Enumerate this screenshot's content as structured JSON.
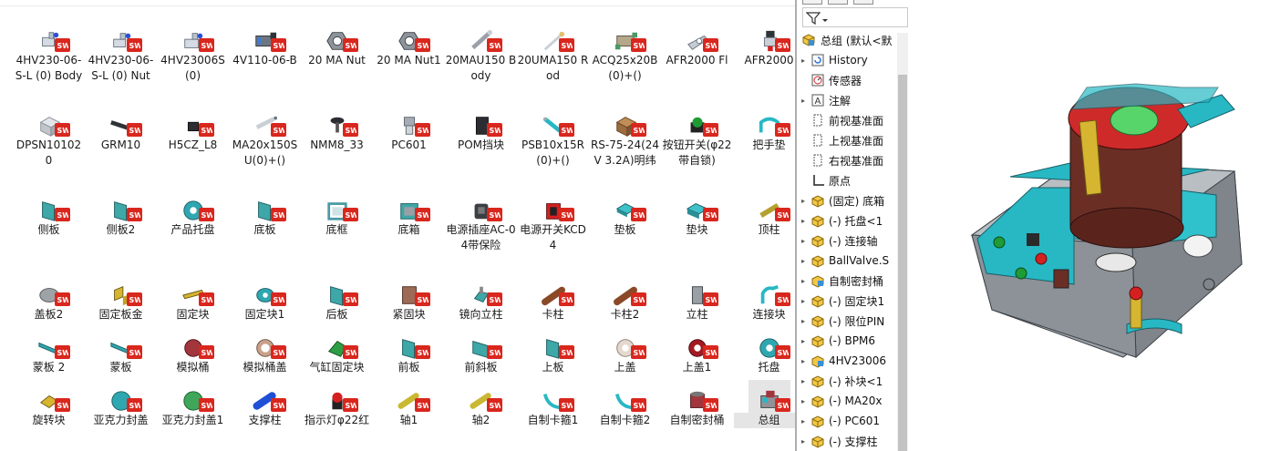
{
  "file_browser": {
    "items": [
      {
        "name": "4HV230-06-S-L (0) Body",
        "icon": "valve-body-icon",
        "rows": 1
      },
      {
        "name": "4HV230-06-S-L (0) Nut",
        "icon": "valve-nut-icon",
        "rows": 1
      },
      {
        "name": "4HV23006S(0)",
        "icon": "valve-icon",
        "rows": 1
      },
      {
        "name": "4V110-06-B",
        "icon": "solenoid-valve-icon",
        "rows": 1
      },
      {
        "name": "20 MA Nut",
        "icon": "hex-nut-icon",
        "rows": 1
      },
      {
        "name": "20 MA Nut1",
        "icon": "hex-nut-icon",
        "rows": 1
      },
      {
        "name": "20MAU150 Body",
        "icon": "cylinder-body-icon",
        "rows": 1
      },
      {
        "name": "20UMA150 Rod",
        "icon": "rod-icon",
        "rows": 1
      },
      {
        "name": "ACQ25x20B(0)+()",
        "icon": "compact-cylinder-icon",
        "rows": 1
      },
      {
        "name": "AFR2000 Fl",
        "icon": "bracket-icon",
        "rows": 1
      },
      {
        "name": "AFR2000",
        "icon": "filter-regulator-icon",
        "rows": 1
      },
      {
        "name": "DPSN101020",
        "icon": "box-part-icon",
        "rows": 2
      },
      {
        "name": "GRM10",
        "icon": "shaft-icon",
        "rows": 2
      },
      {
        "name": "H5CZ_L8",
        "icon": "small-block-icon",
        "rows": 2
      },
      {
        "name": "MA20x150SU(0)+()",
        "icon": "cylinder-icon",
        "rows": 2
      },
      {
        "name": "NMM8_33",
        "icon": "knob-icon",
        "rows": 2
      },
      {
        "name": "PC601",
        "icon": "fitting-icon",
        "rows": 2
      },
      {
        "name": "POM挡块",
        "icon": "stop-block-icon",
        "rows": 2
      },
      {
        "name": "PSB10x15R(0)+()",
        "icon": "spring-plunger-icon",
        "rows": 2
      },
      {
        "name": "RS-75-24(24V 3.2A)明纬",
        "icon": "power-supply-icon",
        "rows": 2
      },
      {
        "name": "按钮开关(φ22带自锁)",
        "icon": "push-button-icon",
        "rows": 2
      },
      {
        "name": "把手垫",
        "icon": "handle-icon",
        "rows": 2
      },
      {
        "name": "侧板",
        "icon": "plate-icon",
        "rows": 3
      },
      {
        "name": "侧板2",
        "icon": "plate-icon",
        "rows": 3
      },
      {
        "name": "产品托盘",
        "icon": "tray-icon",
        "rows": 3
      },
      {
        "name": "底板",
        "icon": "plate-icon",
        "rows": 3
      },
      {
        "name": "底框",
        "icon": "frame-icon",
        "rows": 3
      },
      {
        "name": "底箱",
        "icon": "box-icon",
        "rows": 3
      },
      {
        "name": "电源插座AC-04带保险",
        "icon": "socket-icon",
        "rows": 3
      },
      {
        "name": "电源开关KCD4",
        "icon": "switch-icon",
        "rows": 3
      },
      {
        "name": "垫板",
        "icon": "pad-plate-icon",
        "rows": 3
      },
      {
        "name": "垫块",
        "icon": "pad-block-icon",
        "rows": 3
      },
      {
        "name": "顶柱",
        "icon": "top-pillar-icon",
        "rows": 3
      },
      {
        "name": "盖板2",
        "icon": "cover-plate-icon",
        "rows": 4
      },
      {
        "name": "固定板金",
        "icon": "sheet-metal-icon",
        "rows": 4
      },
      {
        "name": "固定块",
        "icon": "fixed-block-icon",
        "rows": 4
      },
      {
        "name": "固定块1",
        "icon": "cylinder-part-icon",
        "rows": 4
      },
      {
        "name": "后板",
        "icon": "plate-icon",
        "rows": 4
      },
      {
        "name": "紧固块",
        "icon": "clamp-block-icon",
        "rows": 4
      },
      {
        "name": "镜向立柱",
        "icon": "pillar-icon",
        "rows": 4
      },
      {
        "name": "卡柱",
        "icon": "pin-icon",
        "rows": 4
      },
      {
        "name": "卡柱2",
        "icon": "pin-icon",
        "rows": 4
      },
      {
        "name": "立柱",
        "icon": "post-icon",
        "rows": 4
      },
      {
        "name": "连接块",
        "icon": "connector-icon",
        "rows": 4
      },
      {
        "name": "蒙板 2",
        "icon": "mask-plate-icon",
        "rows": 5
      },
      {
        "name": "蒙板",
        "icon": "mask-plate-icon",
        "rows": 5
      },
      {
        "name": "模拟桶",
        "icon": "barrel-icon",
        "rows": 5
      },
      {
        "name": "模拟桶盖",
        "icon": "ring-icon",
        "rows": 5
      },
      {
        "name": "气缸固定块",
        "icon": "bracket-green-icon",
        "rows": 5
      },
      {
        "name": "前板",
        "icon": "plate-icon",
        "rows": 5
      },
      {
        "name": "前斜板",
        "icon": "slant-plate-icon",
        "rows": 5
      },
      {
        "name": "上板",
        "icon": "plate-icon",
        "rows": 5
      },
      {
        "name": "上盖",
        "icon": "washer-icon",
        "rows": 5
      },
      {
        "name": "上盖1",
        "icon": "washer-red-icon",
        "rows": 5
      },
      {
        "name": "托盘",
        "icon": "tray-icon",
        "rows": 5
      },
      {
        "name": "旋转块",
        "icon": "rotary-block-icon",
        "rows": 6
      },
      {
        "name": "亚克力封盖",
        "icon": "disc-icon",
        "rows": 6
      },
      {
        "name": "亚克力封盖1",
        "icon": "disc-green-icon",
        "rows": 6
      },
      {
        "name": "支撑柱",
        "icon": "support-pillar-icon",
        "rows": 6
      },
      {
        "name": "指示灯φ22红",
        "icon": "indicator-light-icon",
        "rows": 6
      },
      {
        "name": "轴1",
        "icon": "shaft-yellow-icon",
        "rows": 6
      },
      {
        "name": "轴2",
        "icon": "shaft-yellow-icon",
        "rows": 6
      },
      {
        "name": "自制卡箍1",
        "icon": "clip-icon",
        "rows": 6
      },
      {
        "name": "自制卡箍2",
        "icon": "clip-icon",
        "rows": 6
      },
      {
        "name": "自制密封桶",
        "icon": "seal-barrel-icon",
        "rows": 6
      },
      {
        "name": "总组",
        "icon": "assembly-icon",
        "rows": 6,
        "selected": true
      }
    ]
  },
  "feature_tree": {
    "root_label": "总组 (默认<默",
    "items": [
      {
        "label": "History",
        "icon": "history-icon",
        "expand": true
      },
      {
        "label": "传感器",
        "icon": "sensor-icon",
        "expand": false
      },
      {
        "label": "注解",
        "icon": "annotation-icon",
        "expand": true
      },
      {
        "label": "前视基准面",
        "icon": "plane-icon",
        "expand": false
      },
      {
        "label": "上视基准面",
        "icon": "plane-icon",
        "expand": false
      },
      {
        "label": "右视基准面",
        "icon": "plane-icon",
        "expand": false
      },
      {
        "label": "原点",
        "icon": "origin-icon",
        "expand": false
      },
      {
        "label": "(固定) 底箱",
        "icon": "part-icon",
        "expand": true
      },
      {
        "label": "(-) 托盘<1",
        "icon": "part-icon",
        "expand": true
      },
      {
        "label": "(-) 连接轴",
        "icon": "part-icon",
        "expand": true
      },
      {
        "label": "BallValve.S",
        "icon": "part-icon",
        "expand": true
      },
      {
        "label": "自制密封桶",
        "icon": "subassembly-icon",
        "expand": true
      },
      {
        "label": "(-) 固定块1",
        "icon": "part-icon",
        "expand": true
      },
      {
        "label": "(-) 限位PIN",
        "icon": "part-icon",
        "expand": true
      },
      {
        "label": "(-) BPM6",
        "icon": "part-icon",
        "expand": true
      },
      {
        "label": "4HV23006",
        "icon": "subassembly-icon",
        "expand": true
      },
      {
        "label": "(-) 补块<1",
        "icon": "part-icon",
        "expand": true
      },
      {
        "label": "(-) MA20x",
        "icon": "part-icon",
        "expand": true
      },
      {
        "label": "(-) PC601",
        "icon": "part-icon",
        "expand": true
      },
      {
        "label": "(-) 支撑柱",
        "icon": "part-icon",
        "expand": true
      }
    ]
  },
  "colors": {
    "sw_badge": "#d9271e",
    "machine_cyan": "#27b8c4",
    "machine_grey": "#8f9398",
    "barrel_brown": "#6b2e25",
    "top_red": "#cf2a2a"
  }
}
